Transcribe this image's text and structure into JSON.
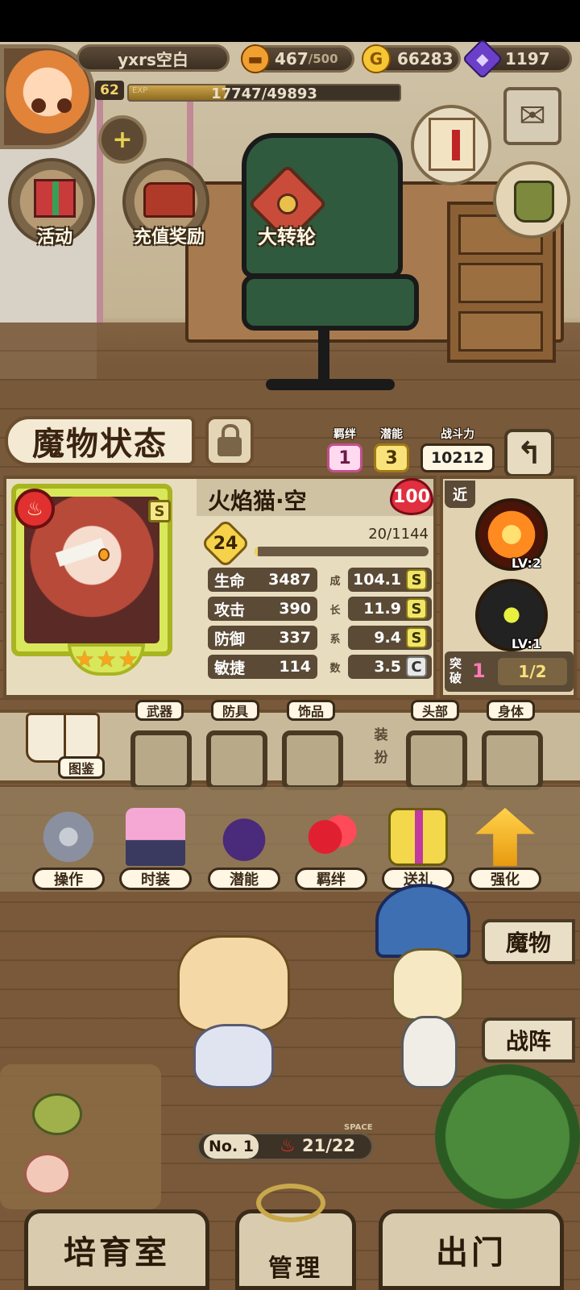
{
  "hud": {
    "username": "yxrs空白",
    "level": "62",
    "exp_label": "EXP",
    "exp_text": "17747/49893",
    "exp_fraction": 0.356,
    "bread": "467",
    "bread_max": "/500",
    "gold": "66283",
    "gems": "1197",
    "gold_symbol": "G"
  },
  "room_buttons": {
    "activity": "活动",
    "recharge_reward": "充值奖励",
    "big_wheel": "大转轮"
  },
  "panel": {
    "title": "魔物状态",
    "bond_caption": "羁绊",
    "bond_value": "1",
    "potential_caption": "潜能",
    "potential_value": "3",
    "power_caption": "战斗力",
    "power_value": "10212"
  },
  "monster": {
    "name": "火焰猫·空",
    "max_level": "100",
    "rank": "S",
    "level": "24",
    "exp_text": "20/1144",
    "exp_fraction": 0.017,
    "stars": 3,
    "stats": [
      {
        "label": "生命",
        "value": "3487",
        "growth": "104.1",
        "grade": "S"
      },
      {
        "label": "攻击",
        "value": "390",
        "growth": "11.9",
        "grade": "S"
      },
      {
        "label": "防御",
        "value": "337",
        "growth": "9.4",
        "grade": "S"
      },
      {
        "label": "敏捷",
        "value": "114",
        "growth": "3.5",
        "grade": "C"
      }
    ],
    "growth_chars": [
      "成",
      "长",
      "系",
      "数"
    ],
    "range": "近",
    "skills": [
      {
        "level": "LV:2"
      },
      {
        "level": "LV:1"
      }
    ],
    "break_label": "突破",
    "break_value": "1",
    "break_progress": "1/2"
  },
  "equipment": {
    "codex": "图鉴",
    "slots": [
      "武器",
      "防具",
      "饰品",
      "头部",
      "身体"
    ],
    "outfit_label": "装扮"
  },
  "actions": [
    "操作",
    "时装",
    "潜能",
    "羁绊",
    "送礼",
    "强化"
  ],
  "side_tabs": {
    "monsters": "魔物",
    "formation": "战阵"
  },
  "room_info": {
    "number_label": "No. 1",
    "capacity": "21/22",
    "space_label": "SPACE"
  },
  "bottom_nav": {
    "nursery": "培育室",
    "manage": "管理",
    "go_out": "出门"
  },
  "colors": {
    "accent_gold": "#f3d35a",
    "card_frame": "#d8e85a",
    "heart_red": "#e02f3e"
  }
}
